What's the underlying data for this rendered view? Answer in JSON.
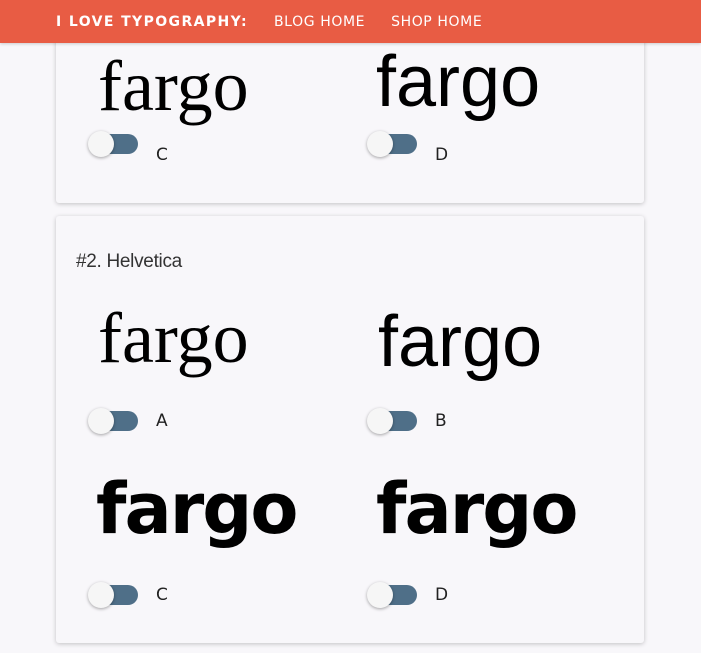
{
  "nav": {
    "brand": "I LOVE TYPOGRAPHY:",
    "links": [
      "BLOG HOME",
      "SHOP HOME"
    ]
  },
  "colors": {
    "nav_background": "#e85c44",
    "toggle_track": "#4f6f88",
    "page_background": "#f8f7fa"
  },
  "card1": {
    "options": [
      {
        "sample": "fargo",
        "label": "C"
      },
      {
        "sample": "fargo",
        "label": "D"
      }
    ]
  },
  "card2": {
    "title": "#2. Helvetica",
    "options": [
      {
        "sample": "fargo",
        "label": "A"
      },
      {
        "sample": "fargo",
        "label": "B"
      },
      {
        "sample": "fargo",
        "label": "C"
      },
      {
        "sample": "fargo",
        "label": "D"
      }
    ]
  }
}
